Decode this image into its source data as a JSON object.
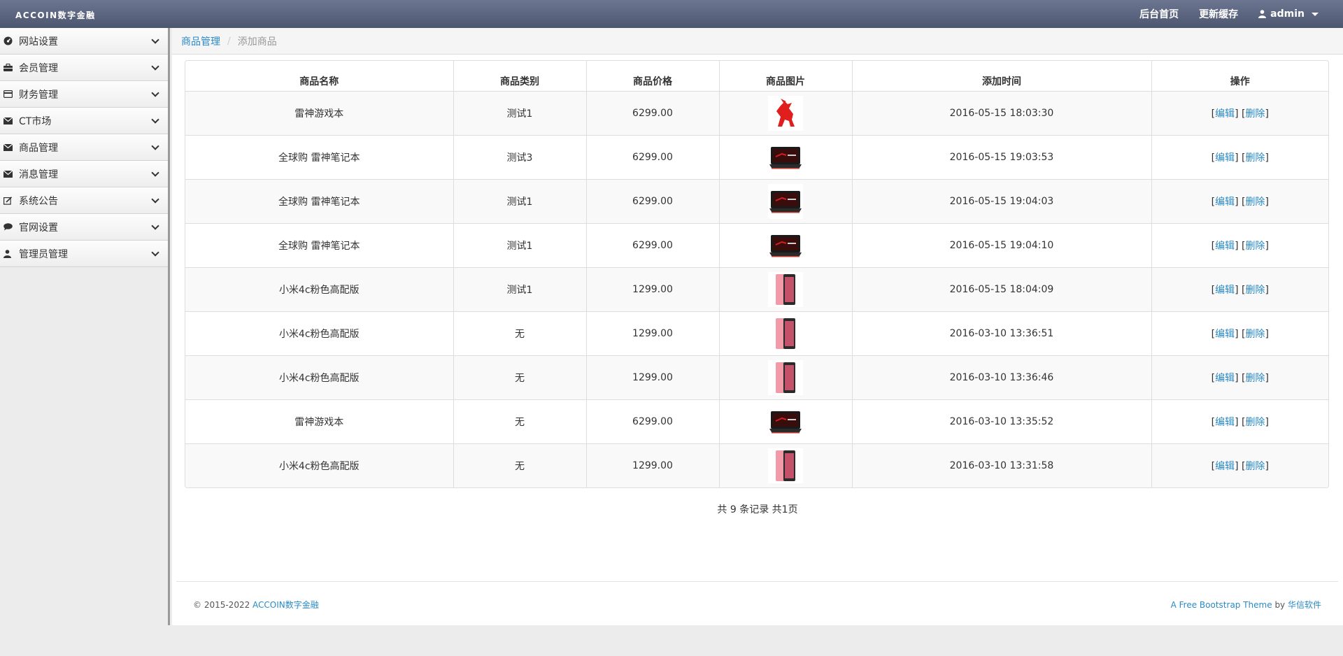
{
  "header": {
    "brand": "ACCOIN数字金融",
    "nav": [
      {
        "label": "后台首页"
      },
      {
        "label": "更新缓存"
      }
    ],
    "user": "admin"
  },
  "sidebar": {
    "items": [
      {
        "label": "网站设置",
        "icon": "dashboard-icon"
      },
      {
        "label": "会员管理",
        "icon": "briefcase-icon"
      },
      {
        "label": "财务管理",
        "icon": "credit-card-icon"
      },
      {
        "label": "CT市场",
        "icon": "envelope-icon"
      },
      {
        "label": "商品管理",
        "icon": "envelope-icon"
      },
      {
        "label": "消息管理",
        "icon": "envelope-icon"
      },
      {
        "label": "系统公告",
        "icon": "edit-icon"
      },
      {
        "label": "官网设置",
        "icon": "comment-icon"
      },
      {
        "label": "管理员管理",
        "icon": "user-icon"
      }
    ]
  },
  "breadcrumb": {
    "parent": "商品管理",
    "current": "添加商品"
  },
  "table": {
    "headers": [
      "商品名称",
      "商品类别",
      "商品价格",
      "商品图片",
      "添加时间",
      "操作"
    ],
    "rows": [
      {
        "name": "雷神游戏本",
        "category": "测试1",
        "price": "6299.00",
        "image": "horse-logo",
        "time": "2016-05-15 18:03:30"
      },
      {
        "name": "全球购 雷神笔记本",
        "category": "测试3",
        "price": "6299.00",
        "image": "laptop",
        "time": "2016-05-15 19:03:53"
      },
      {
        "name": "全球购 雷神笔记本",
        "category": "测试1",
        "price": "6299.00",
        "image": "laptop",
        "time": "2016-05-15 19:04:03"
      },
      {
        "name": "全球购 雷神笔记本",
        "category": "测试1",
        "price": "6299.00",
        "image": "laptop",
        "time": "2016-05-15 19:04:10"
      },
      {
        "name": "小米4c粉色高配版",
        "category": "测试1",
        "price": "1299.00",
        "image": "phone",
        "time": "2016-05-15 18:04:09"
      },
      {
        "name": "小米4c粉色高配版",
        "category": "无",
        "price": "1299.00",
        "image": "phone",
        "time": "2016-03-10 13:36:51"
      },
      {
        "name": "小米4c粉色高配版",
        "category": "无",
        "price": "1299.00",
        "image": "phone",
        "time": "2016-03-10 13:36:46"
      },
      {
        "name": "雷神游戏本",
        "category": "无",
        "price": "6299.00",
        "image": "laptop",
        "time": "2016-03-10 13:35:52"
      },
      {
        "name": "小米4c粉色高配版",
        "category": "无",
        "price": "1299.00",
        "image": "phone",
        "time": "2016-03-10 13:31:58"
      }
    ],
    "edit_label": "编辑",
    "delete_label": "删除"
  },
  "pager": {
    "text": "共 9 条记录 共1页"
  },
  "footer": {
    "copyright": "© 2015-2022 ",
    "site": "ACCOIN数字金融",
    "theme": "A Free Bootstrap Theme",
    "by": " by ",
    "author": "华信软件"
  },
  "colors": {
    "link": "#2a8ac5",
    "topbar": "#5c6580"
  }
}
